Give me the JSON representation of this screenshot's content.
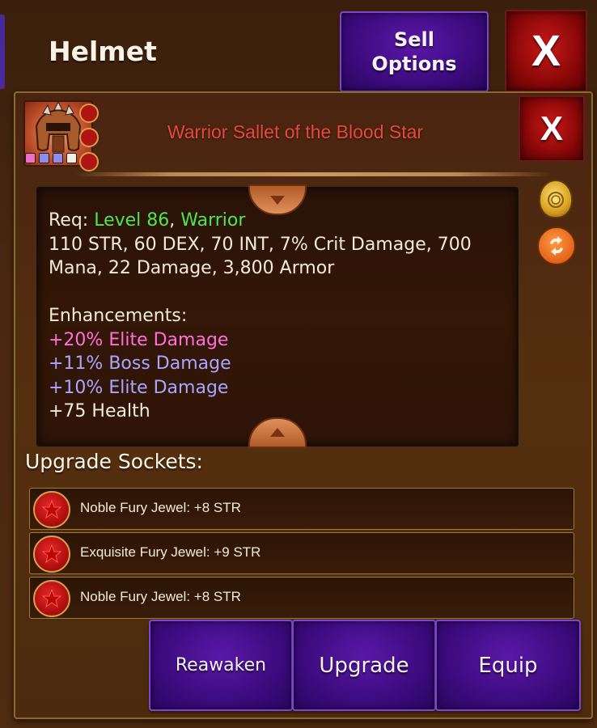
{
  "header": {
    "title": "Helmet",
    "sell_label_line1": "Sell",
    "sell_label_line2": "Options",
    "close_glyph": "X"
  },
  "item": {
    "name": "Warrior Sallet of the Blood Star",
    "close_glyph": "X",
    "gem_colors": [
      "#f06ec8",
      "#8e8cf0",
      "#8e8cf0",
      "#f2efe6"
    ],
    "stats": {
      "req_prefix": "Req: ",
      "req_level": "Level 86",
      "req_sep": ", ",
      "req_class": "Warrior",
      "base_line1": "110 STR, 60 DEX, 70 INT, 7% Crit Damage, 700",
      "base_line2": "Mana, 22 Damage, 3,800 Armor",
      "enh_title": "Enhancements:",
      "enh1": "+20% Elite Damage",
      "enh2": "+11% Boss Damage",
      "enh3": "+10% Elite Damage",
      "enh4": "+75 Health"
    }
  },
  "sockets": {
    "title": "Upgrade Sockets:",
    "rows": [
      {
        "label": "Noble Fury Jewel: +8 STR"
      },
      {
        "label": "Exquisite Fury Jewel: +9 STR"
      },
      {
        "label": "Noble Fury Jewel: +8 STR"
      }
    ]
  },
  "buttons": {
    "reawaken": "Reawaken",
    "upgrade": "Upgrade",
    "equip": "Equip"
  },
  "icons": {
    "coin": "coin-bag-icon",
    "swap": "swap-icon",
    "gem": "ruby-star-icon"
  },
  "colors": {
    "item_name": "#e8483e",
    "req_green": "#4ee84a",
    "enh_pink": "#ff6fd8",
    "enh_lavender": "#a9a6ff",
    "button_purple": "#3c0b7e",
    "close_red": "#c81818"
  }
}
